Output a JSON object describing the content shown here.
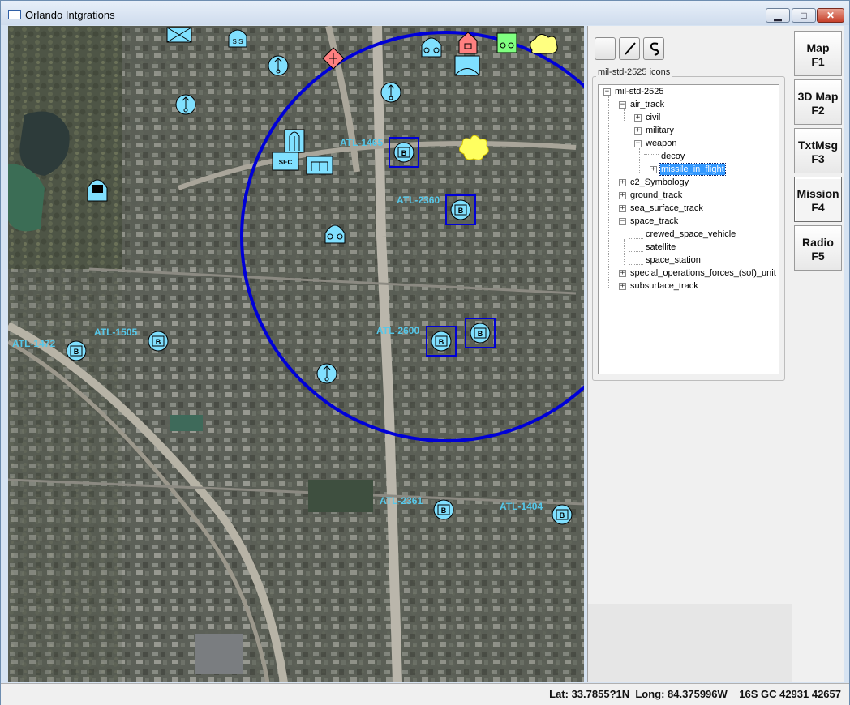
{
  "window": {
    "title": "Orlando Intgrations"
  },
  "map": {
    "track_labels": [
      "ATL-1465",
      "ATL-2360",
      "ATL-1472",
      "ATL-1505",
      "ATL-2600",
      "ATL-2361",
      "ATL-1404"
    ],
    "symbol_text": {
      "sec": "SEC",
      "b": "B"
    },
    "range_ring_color": "#0000d8",
    "label_color": "#56c8ea",
    "symbol_fill": "#80e0ff"
  },
  "toolbar": {
    "tools": [
      "blank-tool",
      "line-tool",
      "curve-tool"
    ]
  },
  "icons_panel": {
    "group_title": "mil-std-2525 icons",
    "tree": {
      "root": "mil-std-2525",
      "air_track": "air_track",
      "civil": "civil",
      "military": "military",
      "weapon": "weapon",
      "decoy": "decoy",
      "missile_in_flight": "missile_in_flight",
      "c2_symbology": "c2_Symbology",
      "ground_track": "ground_track",
      "sea_surface_track": "sea_surface_track",
      "space_track": "space_track",
      "crewed_space_vehicle": "crewed_space_vehicle",
      "satellite": "satellite",
      "space_station": "space_station",
      "sof_unit": "special_operations_forces_(sof)_unit",
      "subsurface_track": "subsurface_track"
    }
  },
  "tabs": [
    {
      "line1": "Map",
      "line2": "F1"
    },
    {
      "line1": "3D Map",
      "line2": "F2"
    },
    {
      "line1": "TxtMsg",
      "line2": "F3"
    },
    {
      "line1": "Mission",
      "line2": "F4"
    },
    {
      "line1": "Radio",
      "line2": "F5"
    }
  ],
  "status": {
    "text": "Lat: 33.7855?1N  Long: 84.375996W    16S GC 42931 42657"
  }
}
